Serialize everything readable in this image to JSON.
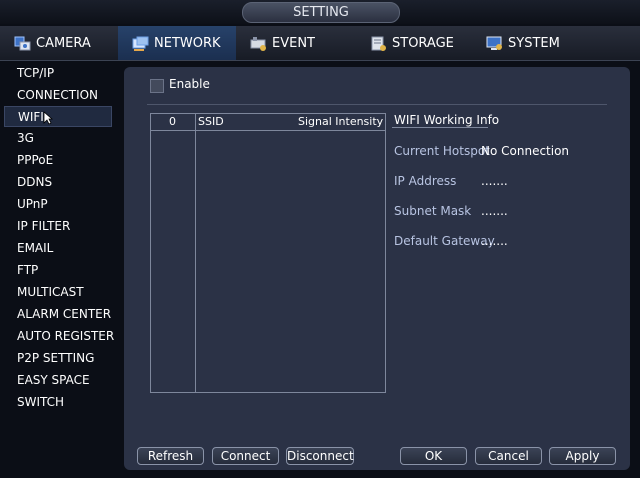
{
  "window": {
    "title": "SETTING"
  },
  "tabs": [
    {
      "label": "CAMERA",
      "icon": "camera-icon"
    },
    {
      "label": "NETWORK",
      "icon": "network-icon",
      "active": true
    },
    {
      "label": "EVENT",
      "icon": "event-icon"
    },
    {
      "label": "STORAGE",
      "icon": "storage-icon"
    },
    {
      "label": "SYSTEM",
      "icon": "system-icon"
    }
  ],
  "sidebar": {
    "items": [
      {
        "label": "TCP/IP"
      },
      {
        "label": "CONNECTION"
      },
      {
        "label": "WIFI",
        "selected": true
      },
      {
        "label": "3G"
      },
      {
        "label": "PPPoE"
      },
      {
        "label": "DDNS"
      },
      {
        "label": "UPnP"
      },
      {
        "label": "IP FILTER"
      },
      {
        "label": "EMAIL"
      },
      {
        "label": "FTP"
      },
      {
        "label": "MULTICAST"
      },
      {
        "label": "ALARM CENTER"
      },
      {
        "label": "AUTO REGISTER"
      },
      {
        "label": "P2P SETTING"
      },
      {
        "label": "EASY SPACE"
      },
      {
        "label": "SWITCH"
      }
    ]
  },
  "wifi": {
    "enable_label": "Enable",
    "enabled": false,
    "table": {
      "columns": [
        "0",
        "SSID",
        "Signal Intensity"
      ],
      "rows": []
    },
    "info": {
      "title": "WIFI Working Info",
      "fields": [
        {
          "label": "Current Hotspot",
          "value": "No Connection"
        },
        {
          "label": "IP Address",
          "value": "......."
        },
        {
          "label": "Subnet Mask",
          "value": "......."
        },
        {
          "label": "Default Gateway",
          "value": "......."
        }
      ]
    }
  },
  "buttons": {
    "refresh": "Refresh",
    "connect": "Connect",
    "disconnect": "Disconnect",
    "ok": "OK",
    "cancel": "Cancel",
    "apply": "Apply"
  },
  "colors": {
    "accent_tab": "#1b2f50",
    "panel": "#2b3246",
    "background": "#0b0e16"
  }
}
